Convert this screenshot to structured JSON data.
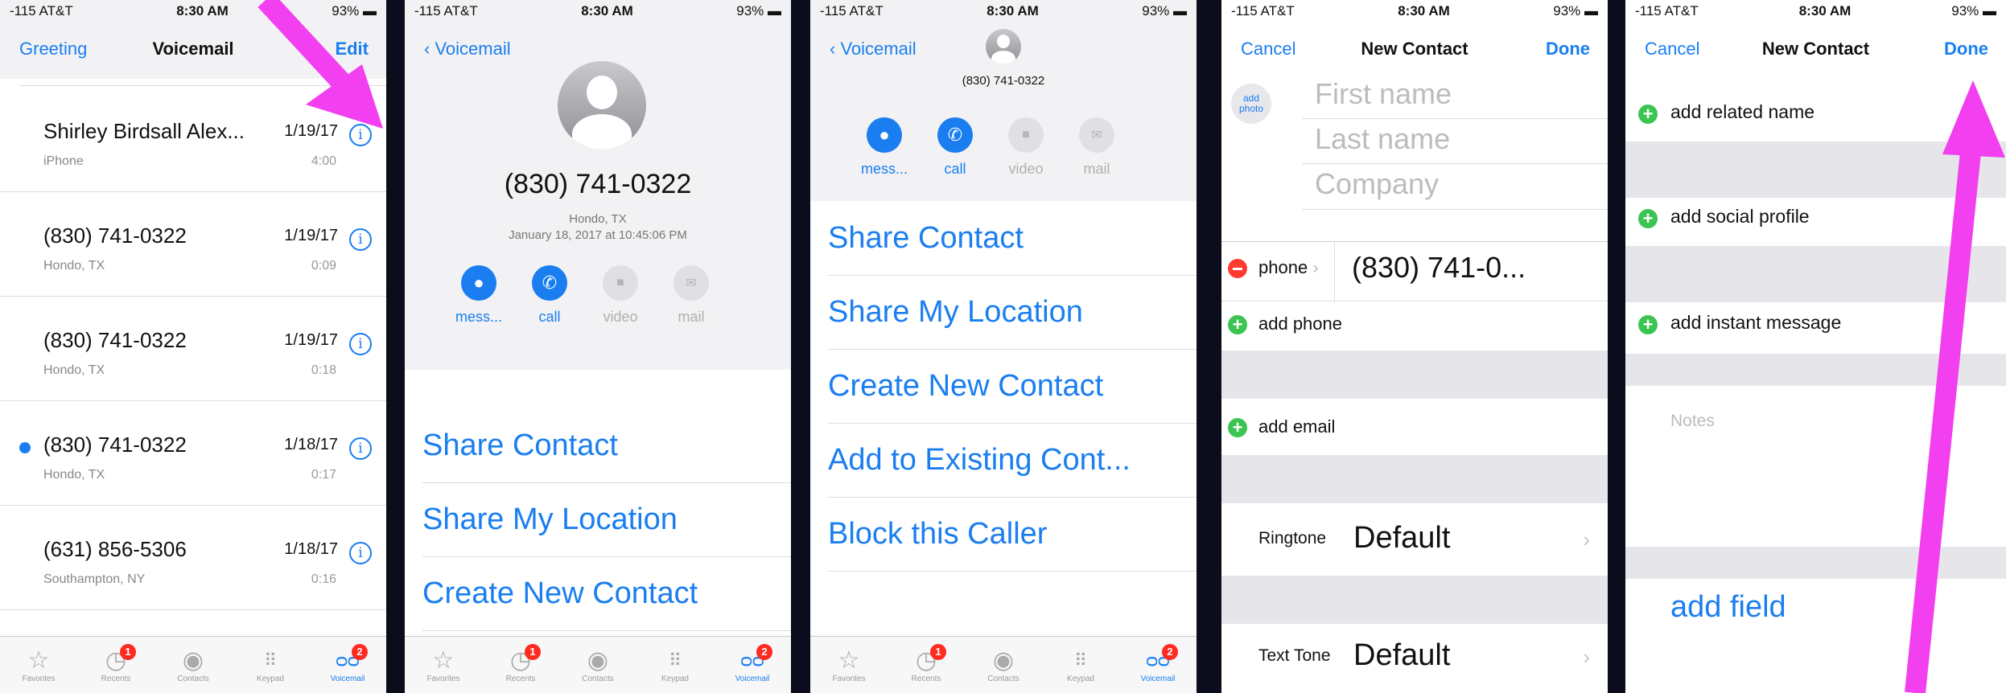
{
  "status": {
    "carrier": "-115 AT&T",
    "time": "8:30 AM",
    "battery": "93%"
  },
  "panel1": {
    "nav": {
      "left": "Greeting",
      "title": "Voicemail",
      "right": "Edit"
    },
    "rows": [
      {
        "name": "Shirley Birdsall Alex...",
        "sub": "iPhone",
        "date": "1/19/17",
        "dur": "4:00"
      },
      {
        "name": "(830) 741-0322",
        "sub": "Hondo, TX",
        "date": "1/19/17",
        "dur": "0:09"
      },
      {
        "name": "(830) 741-0322",
        "sub": "Hondo, TX",
        "date": "1/19/17",
        "dur": "0:18"
      },
      {
        "name": "(830) 741-0322",
        "sub": "Hondo, TX",
        "date": "1/18/17",
        "dur": "0:17"
      },
      {
        "name": "(631) 856-5306",
        "sub": "Southampton, NY",
        "date": "1/18/17",
        "dur": "0:16"
      }
    ]
  },
  "tabs": [
    {
      "label": "Favorites",
      "icon": "star-icon"
    },
    {
      "label": "Recents",
      "icon": "clock-icon",
      "badge": "1"
    },
    {
      "label": "Contacts",
      "icon": "person-icon"
    },
    {
      "label": "Keypad",
      "icon": "keypad-icon"
    },
    {
      "label": "Voicemail",
      "icon": "voicemail-icon",
      "badge": "2"
    }
  ],
  "panel2": {
    "back": "Voicemail",
    "number": "(830) 741-0322",
    "location": "Hondo, TX",
    "datetime": "January 18, 2017 at 10:45:06 PM",
    "actions": [
      "mess...",
      "call",
      "video",
      "mail"
    ],
    "menu": [
      "Share Contact",
      "Share My Location",
      "Create New Contact"
    ]
  },
  "panel3": {
    "back": "Voicemail",
    "number": "(830) 741-0322",
    "actions": [
      "mess...",
      "call",
      "video",
      "mail"
    ],
    "menu": [
      "Share Contact",
      "Share My Location",
      "Create New Contact",
      "Add to Existing Cont...",
      "Block this Caller"
    ]
  },
  "panel4": {
    "nav": {
      "left": "Cancel",
      "title": "New Contact",
      "right": "Done"
    },
    "add_photo": "add photo",
    "first_name": "First name",
    "last_name": "Last name",
    "company": "Company",
    "phone_label": "phone",
    "phone_value": "(830) 741-0...",
    "add_phone": "add phone",
    "add_email": "add email",
    "ringtone_label": "Ringtone",
    "ringtone_value": "Default",
    "texttone_label": "Text Tone",
    "texttone_value": "Default"
  },
  "panel5": {
    "nav": {
      "left": "Cancel",
      "title": "New Contact",
      "right": "Done"
    },
    "add_related": "add related name",
    "add_social": "add social profile",
    "add_im": "add instant message",
    "notes": "Notes",
    "add_field": "add field"
  },
  "colors": {
    "accent": "#1a7ef0",
    "arrow": "#f23ff0",
    "badge": "#ff2a20",
    "green": "#3bc452",
    "red": "#ff3b30"
  }
}
